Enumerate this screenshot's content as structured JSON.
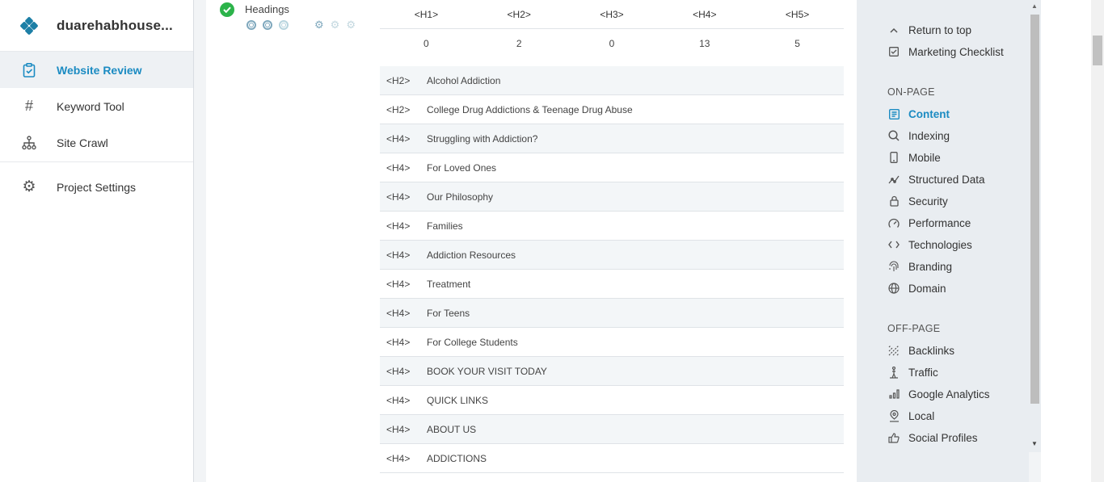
{
  "sidebar": {
    "brand": "duarehabhouse...",
    "items": [
      {
        "label": "Website Review",
        "icon": "clipboard-check-icon",
        "active": true
      },
      {
        "label": "Keyword Tool",
        "icon": "hash-icon"
      },
      {
        "label": "Site Crawl",
        "icon": "sitemap-icon"
      }
    ],
    "settings": {
      "label": "Project Settings",
      "icon": "gear-icon"
    }
  },
  "headings": {
    "title": "Headings",
    "columns": [
      "<H1>",
      "<H2>",
      "<H3>",
      "<H4>",
      "<H5>"
    ],
    "counts": [
      "0",
      "2",
      "0",
      "13",
      "5"
    ],
    "rows": [
      {
        "tag": "<H2>",
        "text": "Alcohol Addiction"
      },
      {
        "tag": "<H2>",
        "text": "College Drug Addictions & Teenage Drug Abuse"
      },
      {
        "tag": "<H4>",
        "text": "Struggling with Addiction?"
      },
      {
        "tag": "<H4>",
        "text": "For Loved Ones"
      },
      {
        "tag": "<H4>",
        "text": "Our Philosophy"
      },
      {
        "tag": "<H4>",
        "text": "Families"
      },
      {
        "tag": "<H4>",
        "text": "Addiction Resources"
      },
      {
        "tag": "<H4>",
        "text": "Treatment"
      },
      {
        "tag": "<H4>",
        "text": "For Teens"
      },
      {
        "tag": "<H4>",
        "text": "For College Students"
      },
      {
        "tag": "<H4>",
        "text": "BOOK YOUR VISIT TODAY"
      },
      {
        "tag": "<H4>",
        "text": "QUICK LINKS"
      },
      {
        "tag": "<H4>",
        "text": "ABOUT US"
      },
      {
        "tag": "<H4>",
        "text": "ADDICTIONS"
      }
    ]
  },
  "rightnav": {
    "top": [
      {
        "label": "Return to top",
        "icon": "chevron-up-icon"
      },
      {
        "label": "Marketing Checklist",
        "icon": "checkbox-icon"
      }
    ],
    "onpage_title": "ON-PAGE",
    "onpage": [
      {
        "label": "Content",
        "icon": "document-icon",
        "active": true
      },
      {
        "label": "Indexing",
        "icon": "search-icon"
      },
      {
        "label": "Mobile",
        "icon": "mobile-icon"
      },
      {
        "label": "Structured Data",
        "icon": "graph-icon"
      },
      {
        "label": "Security",
        "icon": "lock-icon"
      },
      {
        "label": "Performance",
        "icon": "speedometer-icon"
      },
      {
        "label": "Technologies",
        "icon": "code-icon"
      },
      {
        "label": "Branding",
        "icon": "fingerprint-icon"
      },
      {
        "label": "Domain",
        "icon": "globe-icon"
      }
    ],
    "offpage_title": "OFF-PAGE",
    "offpage": [
      {
        "label": "Backlinks",
        "icon": "backlinks-icon"
      },
      {
        "label": "Traffic",
        "icon": "traffic-icon"
      },
      {
        "label": "Google Analytics",
        "icon": "bar-chart-icon"
      },
      {
        "label": "Local",
        "icon": "map-pin-icon"
      },
      {
        "label": "Social Profiles",
        "icon": "thumbs-up-icon"
      }
    ]
  },
  "colors": {
    "accent": "#1b8bc2",
    "success": "#2cb34a",
    "brand": "#1d7fa6"
  }
}
